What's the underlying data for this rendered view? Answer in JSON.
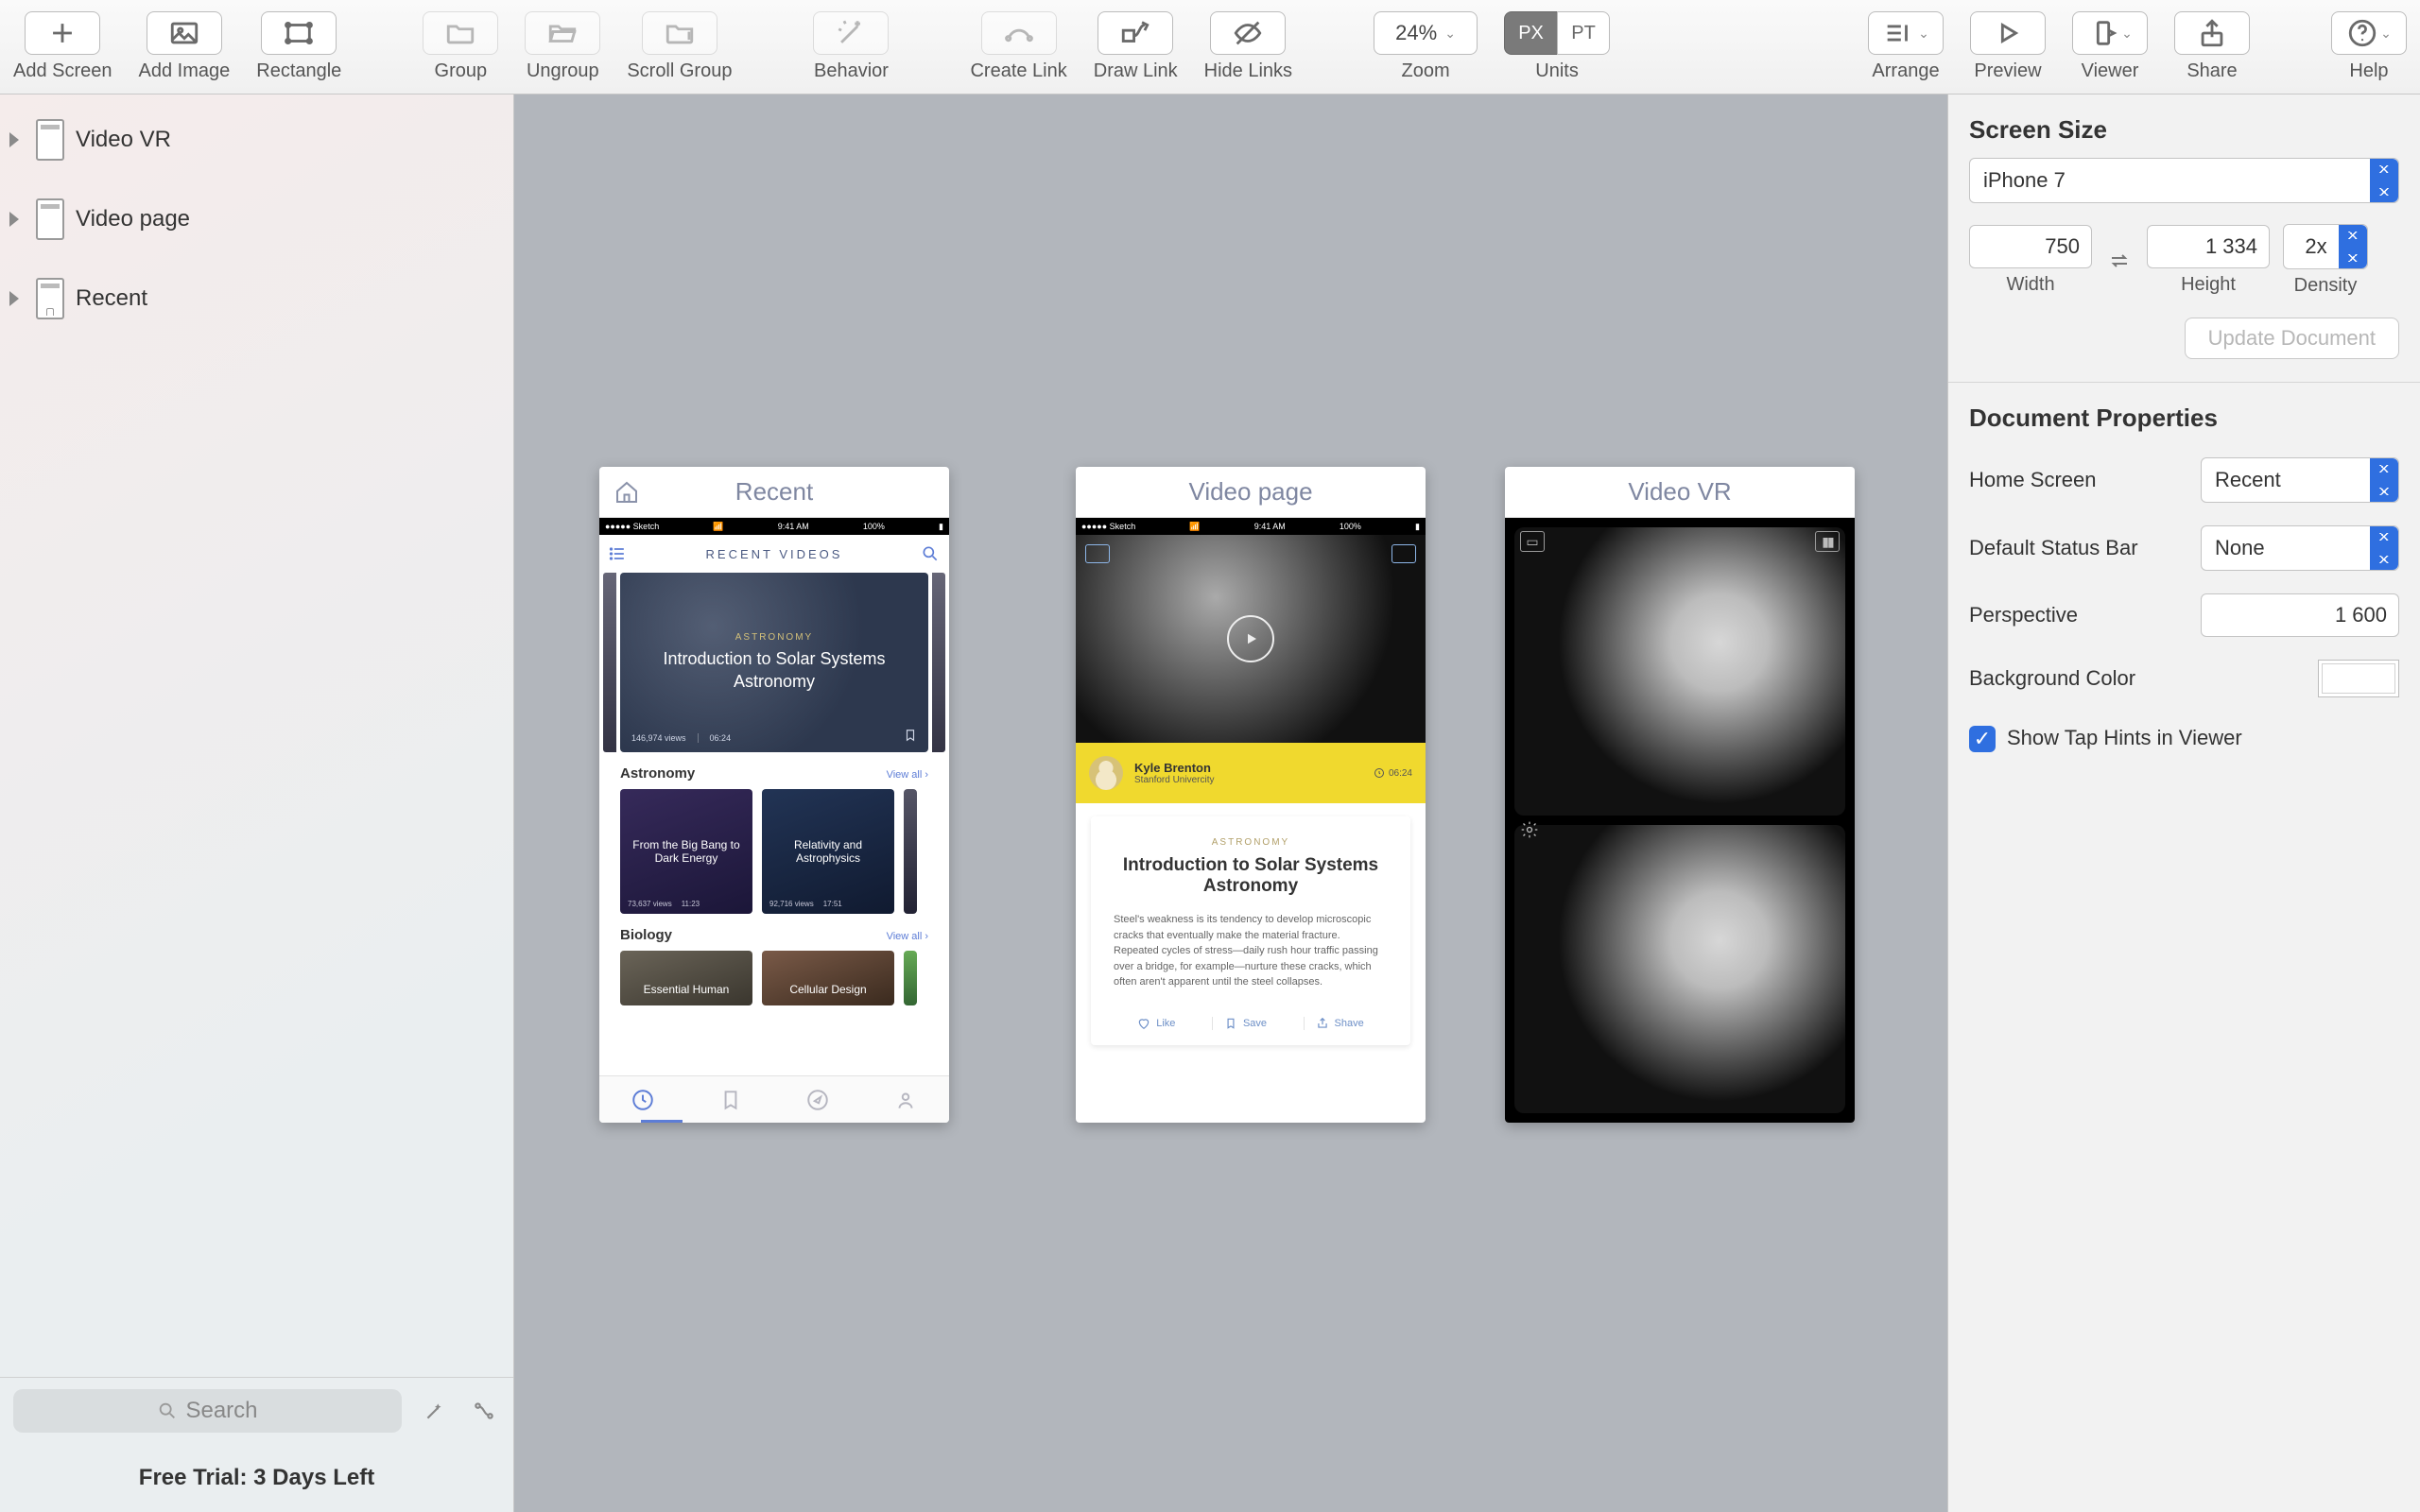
{
  "toolbar": {
    "add_screen": "Add Screen",
    "add_image": "Add Image",
    "rectangle": "Rectangle",
    "group": "Group",
    "ungroup": "Ungroup",
    "scroll_group": "Scroll Group",
    "behavior": "Behavior",
    "create_link": "Create Link",
    "draw_link": "Draw Link",
    "hide_links": "Hide Links",
    "zoom_value": "24%",
    "zoom_label": "Zoom",
    "units_px": "PX",
    "units_pt": "PT",
    "units_label": "Units",
    "arrange": "Arrange",
    "preview": "Preview",
    "viewer": "Viewer",
    "share": "Share",
    "help": "Help"
  },
  "sidebar": {
    "items": [
      {
        "label": "Video VR"
      },
      {
        "label": "Video page"
      },
      {
        "label": "Recent"
      }
    ],
    "search_placeholder": "Search",
    "trial": "Free Trial: 3 Days Left"
  },
  "canvas": {
    "artboards": [
      {
        "title": "Recent",
        "status": {
          "carrier": "●●●●● Sketch",
          "wifi": true,
          "time": "9:41 AM",
          "battery": "100%"
        },
        "header": "RECENT VIDEOS",
        "hero": {
          "category": "ASTRONOMY",
          "title": "Introduction to Solar Systems Astronomy",
          "views": "146,974 views",
          "duration": "06:24"
        },
        "sections": [
          {
            "name": "Astronomy",
            "view_all": "View all ›",
            "cards": [
              {
                "title": "From the Big Bang to Dark Energy",
                "views": "73,637 views",
                "dur": "11:23"
              },
              {
                "title": "Relativity and Astrophysics",
                "views": "92,716 views",
                "dur": "17:51"
              }
            ]
          },
          {
            "name": "Biology",
            "view_all": "View all ›",
            "cards": [
              {
                "title": "Essential Human"
              },
              {
                "title": "Cellular Design"
              }
            ]
          }
        ]
      },
      {
        "title": "Video page",
        "status": {
          "carrier": "●●●●● Sketch",
          "wifi": true,
          "time": "9:41 AM",
          "battery": "100%"
        },
        "author": {
          "name": "Kyle Brenton",
          "uni": "Stanford Univercity",
          "dur": "06:24"
        },
        "card": {
          "category": "ASTRONOMY",
          "title": "Introduction to Solar Systems Astronomy",
          "body": "Steel's weakness is its tendency to develop microscopic cracks that eventually make the material fracture. Repeated cycles of stress—daily rush hour traffic passing over a bridge, for example—nurture these cracks, which often aren't apparent until the steel collapses.",
          "like": "Like",
          "save": "Save",
          "share": "Shave"
        }
      },
      {
        "title": "Video VR"
      }
    ]
  },
  "inspector": {
    "screen_size_h": "Screen Size",
    "device": "iPhone 7",
    "width": "750",
    "width_l": "Width",
    "height": "1 334",
    "height_l": "Height",
    "density": "2x",
    "density_l": "Density",
    "update": "Update Document",
    "doc_props_h": "Document Properties",
    "home_screen_l": "Home Screen",
    "home_screen": "Recent",
    "status_bar_l": "Default Status Bar",
    "status_bar": "None",
    "perspective_l": "Perspective",
    "perspective": "1 600",
    "bg_l": "Background Color",
    "tap_hints": "Show Tap Hints in Viewer"
  }
}
